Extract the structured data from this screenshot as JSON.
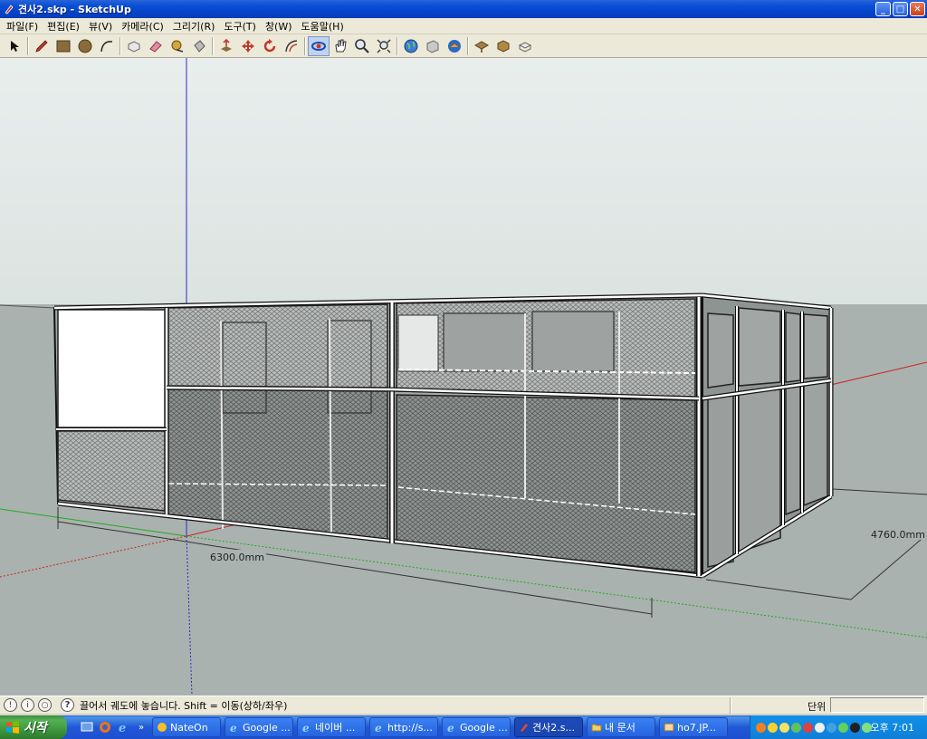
{
  "window": {
    "title": "견사2.skp - SketchUp",
    "min_label": "_",
    "max_label": "□",
    "close_label": "✕"
  },
  "menu": [
    {
      "label": "파일(F)"
    },
    {
      "label": "편집(E)"
    },
    {
      "label": "뷰(V)"
    },
    {
      "label": "카메라(C)"
    },
    {
      "label": "그리기(R)"
    },
    {
      "label": "도구(T)"
    },
    {
      "label": "창(W)"
    },
    {
      "label": "도움말(H)"
    }
  ],
  "toolbar": {
    "tools": [
      {
        "name": "select-tool",
        "icon": "arrow-icon"
      },
      {
        "name": "pencil-tool",
        "icon": "pencil-icon"
      },
      {
        "name": "rectangle-tool",
        "icon": "rectangle-icon"
      },
      {
        "name": "circle-tool",
        "icon": "circle-icon"
      },
      {
        "name": "arc-tool",
        "icon": "arc-icon"
      },
      {
        "name": "make-component-tool",
        "icon": "component-icon"
      },
      {
        "name": "eraser-tool",
        "icon": "eraser-icon"
      },
      {
        "name": "tape-measure-tool",
        "icon": "tape-icon"
      },
      {
        "name": "paint-bucket-tool",
        "icon": "bucket-icon"
      },
      {
        "name": "push-pull-tool",
        "icon": "pushpull-icon"
      },
      {
        "name": "move-tool",
        "icon": "move-icon"
      },
      {
        "name": "rotate-tool",
        "icon": "rotate-icon"
      },
      {
        "name": "offset-tool",
        "icon": "offset-icon"
      },
      {
        "name": "orbit-tool",
        "icon": "orbit-icon",
        "active": true
      },
      {
        "name": "pan-tool",
        "icon": "pan-icon"
      },
      {
        "name": "zoom-tool",
        "icon": "zoom-icon"
      },
      {
        "name": "zoom-extents-tool",
        "icon": "zoom-extents-icon"
      },
      {
        "name": "get-models-tool",
        "icon": "globe-icon"
      },
      {
        "name": "share-model-tool",
        "icon": "share-icon"
      },
      {
        "name": "google-earth-tool",
        "icon": "earth-icon"
      },
      {
        "name": "get-current-view-tool",
        "icon": "view-icon"
      },
      {
        "name": "toggle-terrain-tool",
        "icon": "terrain-icon"
      },
      {
        "name": "place-model-tool",
        "icon": "place-icon"
      }
    ]
  },
  "viewport": {
    "dimension_width": "6300.0mm",
    "dimension_depth": "4760.0mm"
  },
  "status": {
    "message": "끌어서 궤도에 놓습니다. Shift = 이동(상하/좌우)",
    "vcb_label": "단위",
    "vcb_value": ""
  },
  "taskbar": {
    "start_label": "시작",
    "more_label": "»",
    "tasks": [
      {
        "label": "NateOn",
        "icon": "nateon-icon"
      },
      {
        "label": "Google ...",
        "icon": "ie-icon"
      },
      {
        "label": "네이버 ...",
        "icon": "ie-icon"
      },
      {
        "label": "http://s...",
        "icon": "ie-icon"
      },
      {
        "label": "Google ...",
        "icon": "ie-icon"
      },
      {
        "label": "견사2.s...",
        "icon": "sketchup-icon",
        "active": true
      },
      {
        "label": "내 문서",
        "icon": "folder-icon"
      },
      {
        "label": "ho7.JP...",
        "icon": "image-icon"
      }
    ],
    "clock": "오후 7:01"
  },
  "colors": {
    "sky": "#dfe6e4",
    "ground": "#a7b0ad",
    "axis_red": "#cc2222",
    "axis_green": "#22aa22",
    "axis_blue": "#2222cc"
  }
}
